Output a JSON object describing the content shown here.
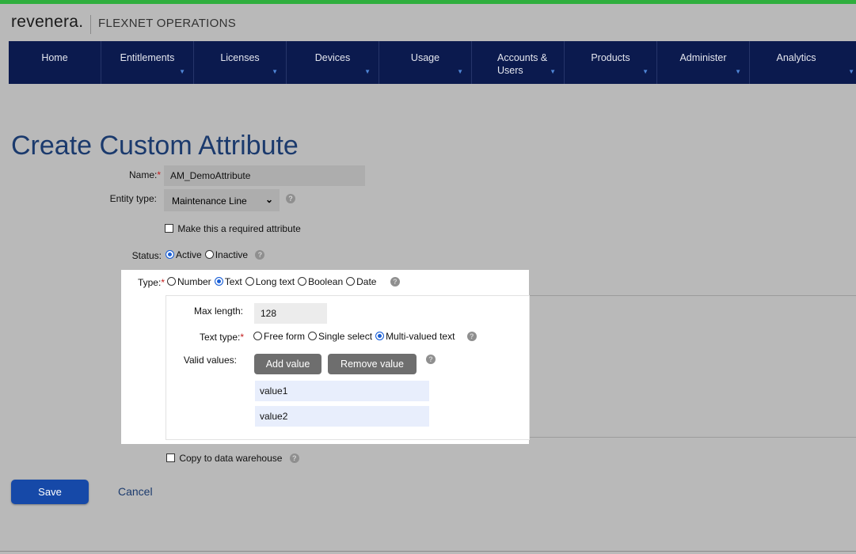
{
  "header": {
    "logo": "revenera.",
    "product": "FLEXNET OPERATIONS"
  },
  "nav": [
    {
      "label": "Home",
      "has_menu": false
    },
    {
      "label": "Entitlements",
      "has_menu": true
    },
    {
      "label": "Licenses",
      "has_menu": true
    },
    {
      "label": "Devices",
      "has_menu": true
    },
    {
      "label": "Usage",
      "has_menu": true
    },
    {
      "label": "Accounts & Users",
      "has_menu": true
    },
    {
      "label": "Products",
      "has_menu": true
    },
    {
      "label": "Administer",
      "has_menu": true
    },
    {
      "label": "Analytics",
      "has_menu": true
    }
  ],
  "page_title": "Create Custom Attribute",
  "form": {
    "name_label": "Name:",
    "name_value": "AM_DemoAttribute",
    "entity_type_label": "Entity type:",
    "entity_type_value": "Maintenance Line",
    "required_checkbox_label": "Make this a required attribute",
    "status_label": "Status:",
    "status_active": "Active",
    "status_inactive": "Inactive",
    "type_label": "Type:",
    "type_options": {
      "number": "Number",
      "text": "Text",
      "long_text": "Long text",
      "boolean": "Boolean",
      "date": "Date"
    },
    "max_length_label": "Max length:",
    "max_length_value": "128",
    "text_type_label": "Text type:",
    "text_type_options": {
      "free_form": "Free form",
      "single_select": "Single select",
      "multi_valued": "Multi-valued text"
    },
    "valid_values_label": "Valid values:",
    "add_value": "Add value",
    "remove_value": "Remove value",
    "values": [
      "value1",
      "value2"
    ],
    "copy_label": "Copy to data warehouse",
    "required_mark": "*",
    "help_glyph": "?"
  },
  "actions": {
    "save": "Save",
    "cancel": "Cancel"
  },
  "colors": {
    "nav_bg": "#0b1a4e",
    "accent_green": "#2fae3e",
    "primary_button": "#1649a8",
    "title": "#1b3a6d"
  }
}
